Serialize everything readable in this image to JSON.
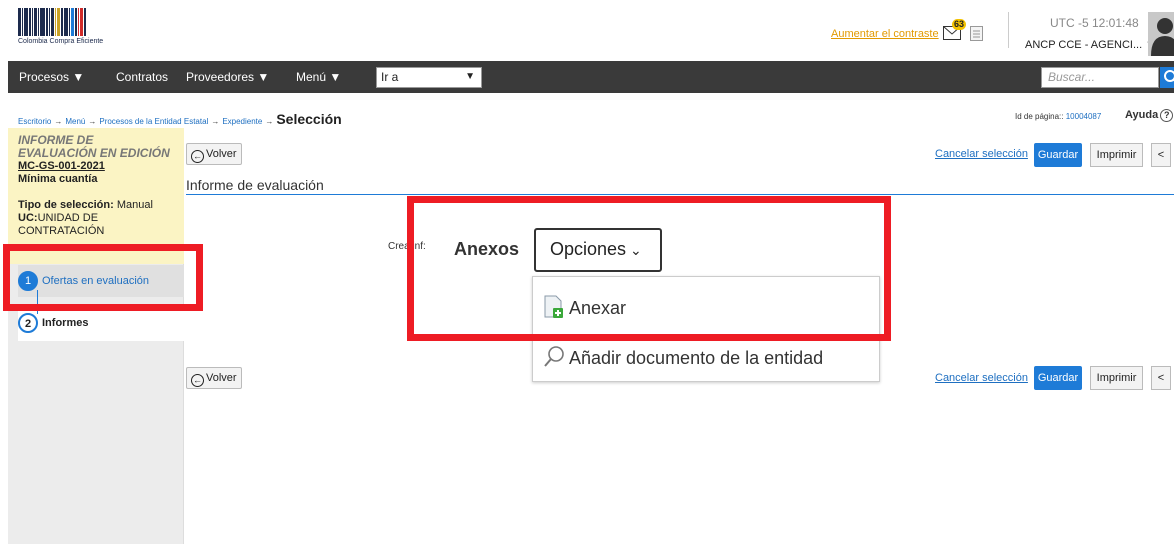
{
  "header": {
    "logo_text": "Colombia Compra Eficiente",
    "contrast_link": "Aumentar el contraste",
    "mail_count": "63",
    "time": "UTC -5 12:01:48",
    "account": "ANCP CCE - AGENCI... ▼"
  },
  "nav": {
    "items": [
      "Procesos ▼",
      "Contratos",
      "Proveedores ▼",
      "Menú ▼"
    ],
    "goto_value": "Ir a",
    "search_placeholder": "Buscar..."
  },
  "breadcrumb": {
    "items": [
      "Escritorio",
      "Menú",
      "Procesos de la Entidad Estatal",
      "Expediente"
    ],
    "current": "Selección",
    "page_id_label": "Id de página:: ",
    "page_id": "10004087",
    "help": "Ayuda"
  },
  "infobox": {
    "title": "INFORME DE EVALUACIÓN EN EDICIÓN",
    "code": "MC-GS-001-2021",
    "modality": "Mínima cuantía",
    "selection_label": "Tipo de selección:",
    "selection_value": " Manual",
    "unit_label": "UC:",
    "unit_value": "UNIDAD DE CONTRATACIÓN"
  },
  "steps": [
    {
      "num": "1",
      "label": "Ofertas en evaluación"
    },
    {
      "num": "2",
      "label": "Informes"
    }
  ],
  "actions": {
    "volver": "Volver",
    "cancel": "Cancelar selección",
    "guardar": "Guardar",
    "imprimir": "Imprimir",
    "less": "<"
  },
  "main": {
    "section_title": "Informe de evaluación",
    "crea_label": "Crea inf:",
    "anexos_label": "Anexos",
    "opciones_label": "Opciones",
    "dropdown": [
      "Anexar",
      "Añadir documento de la entidad"
    ]
  },
  "colors": {
    "accent": "#1e7bd7",
    "highlight": "#ee1c24",
    "navbar": "#3a3a3a",
    "infobox": "#fbf4c4"
  }
}
